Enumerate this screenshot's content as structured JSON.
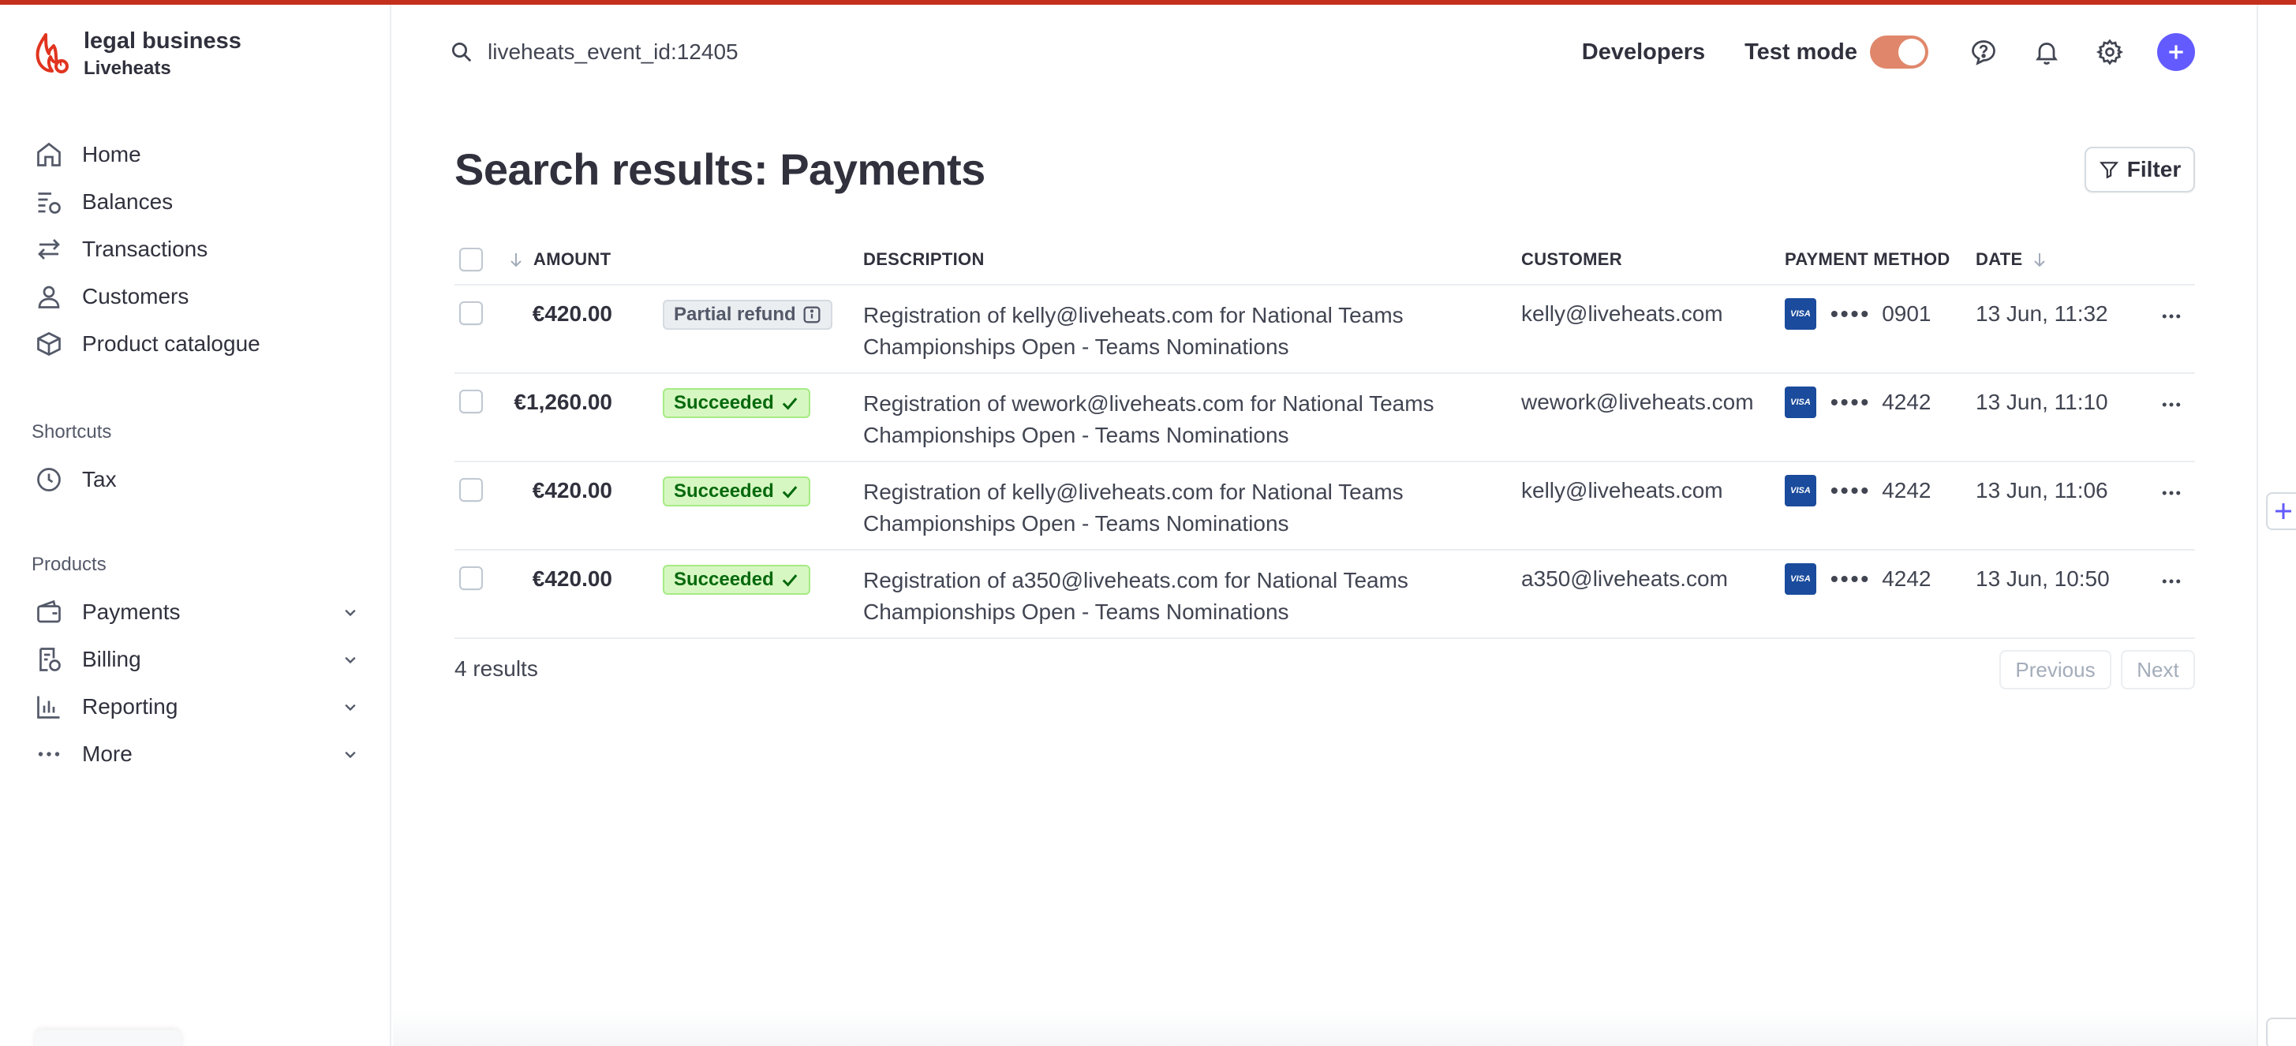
{
  "colors": {
    "accent": "#635bff",
    "brand_red": "#e0341f",
    "toggle_on": "#e0876b",
    "succeeded_bg": "#d7f7c2",
    "succeeded_text": "#05690d"
  },
  "account": {
    "name": "legal business",
    "sub": "Liveheats"
  },
  "sidebar": {
    "items": [
      {
        "label": "Home",
        "icon": "home-icon"
      },
      {
        "label": "Balances",
        "icon": "balances-icon"
      },
      {
        "label": "Transactions",
        "icon": "transactions-icon"
      },
      {
        "label": "Customers",
        "icon": "customers-icon"
      },
      {
        "label": "Product catalogue",
        "icon": "product-catalogue-icon"
      }
    ],
    "shortcuts_label": "Shortcuts",
    "shortcuts": [
      {
        "label": "Tax",
        "icon": "clock-icon"
      }
    ],
    "products_label": "Products",
    "products": [
      {
        "label": "Payments",
        "icon": "wallet-icon"
      },
      {
        "label": "Billing",
        "icon": "billing-icon"
      },
      {
        "label": "Reporting",
        "icon": "chart-icon"
      },
      {
        "label": "More",
        "icon": "ellipsis-icon"
      }
    ]
  },
  "header": {
    "search_value": "liveheats_event_id:12405",
    "developers": "Developers",
    "test_mode": "Test mode",
    "test_mode_on": true
  },
  "page": {
    "title": "Search results: Payments",
    "filter_label": "Filter"
  },
  "table": {
    "columns": {
      "amount": "AMOUNT",
      "description": "DESCRIPTION",
      "customer": "CUSTOMER",
      "payment_method": "PAYMENT METHOD",
      "date": "DATE"
    },
    "rows": [
      {
        "amount": "€420.00",
        "status": "Partial refund",
        "status_type": "partial",
        "description_line1": "Registration of kelly@liveheats.com for National Teams",
        "description_line2": "Championships Open - Teams Nominations",
        "customer": "kelly@liveheats.com",
        "card_brand": "VISA",
        "card_dots": "••••",
        "card_last4": "0901",
        "date": "13 Jun, 11:32"
      },
      {
        "amount": "€1,260.00",
        "status": "Succeeded",
        "status_type": "succeeded",
        "description_line1": "Registration of wework@liveheats.com for National Teams",
        "description_line2": "Championships Open - Teams Nominations",
        "customer": "wework@liveheats.com",
        "card_brand": "VISA",
        "card_dots": "••••",
        "card_last4": "4242",
        "date": "13 Jun, 11:10"
      },
      {
        "amount": "€420.00",
        "status": "Succeeded",
        "status_type": "succeeded",
        "description_line1": "Registration of kelly@liveheats.com for National Teams",
        "description_line2": "Championships Open - Teams Nominations",
        "customer": "kelly@liveheats.com",
        "card_brand": "VISA",
        "card_dots": "••••",
        "card_last4": "4242",
        "date": "13 Jun, 11:06"
      },
      {
        "amount": "€420.00",
        "status": "Succeeded",
        "status_type": "succeeded",
        "description_line1": "Registration of a350@liveheats.com for National Teams",
        "description_line2": "Championships Open - Teams Nominations",
        "customer": "a350@liveheats.com",
        "card_brand": "VISA",
        "card_dots": "••••",
        "card_last4": "4242",
        "date": "13 Jun, 10:50"
      }
    ]
  },
  "footer": {
    "results": "4 results",
    "previous": "Previous",
    "next": "Next"
  }
}
